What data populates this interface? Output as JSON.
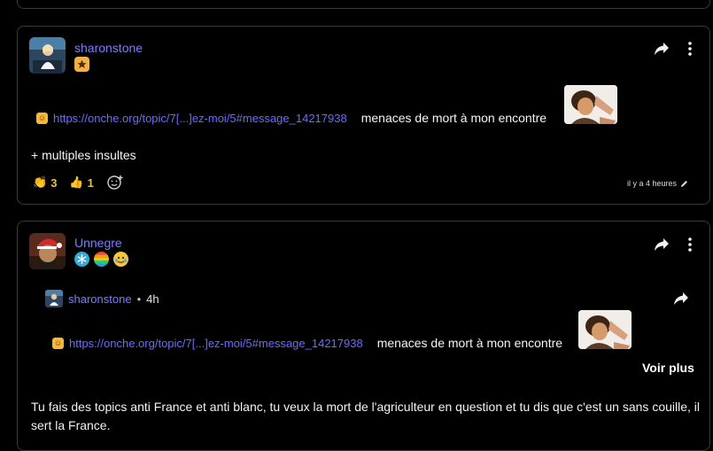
{
  "post1": {
    "username": "sharonstone",
    "link_text": "https://onche.org/topic/7[...]ez-moi/5#message_14217938",
    "text_after_link": "menaces de mort à mon encontre",
    "body_line": "+ multiples insultes",
    "reactions": [
      {
        "icon": "clapping-hands-icon",
        "count": "3"
      },
      {
        "icon": "thumbs-up-icon",
        "count": "1"
      }
    ],
    "timestamp": "il y a 4 heures"
  },
  "post2": {
    "username": "Unnegre",
    "quote": {
      "author": "sharonstone",
      "sep": "•",
      "time": "4h",
      "link_text": "https://onche.org/topic/7[...]ez-moi/5#message_14217938",
      "text_after_link": "menaces de mort à mon encontre",
      "see_more": "Voir plus"
    },
    "body_text": "Tu fais des topics anti France et anti blanc, tu veux la mort de l'agriculteur en question et tu dis que c'est un sans couille, il sert la France."
  },
  "colors": {
    "username": "#7b7bff",
    "link": "#6b6bff",
    "reaction_count": "#e8c14c",
    "border": "#3a3a3a"
  }
}
